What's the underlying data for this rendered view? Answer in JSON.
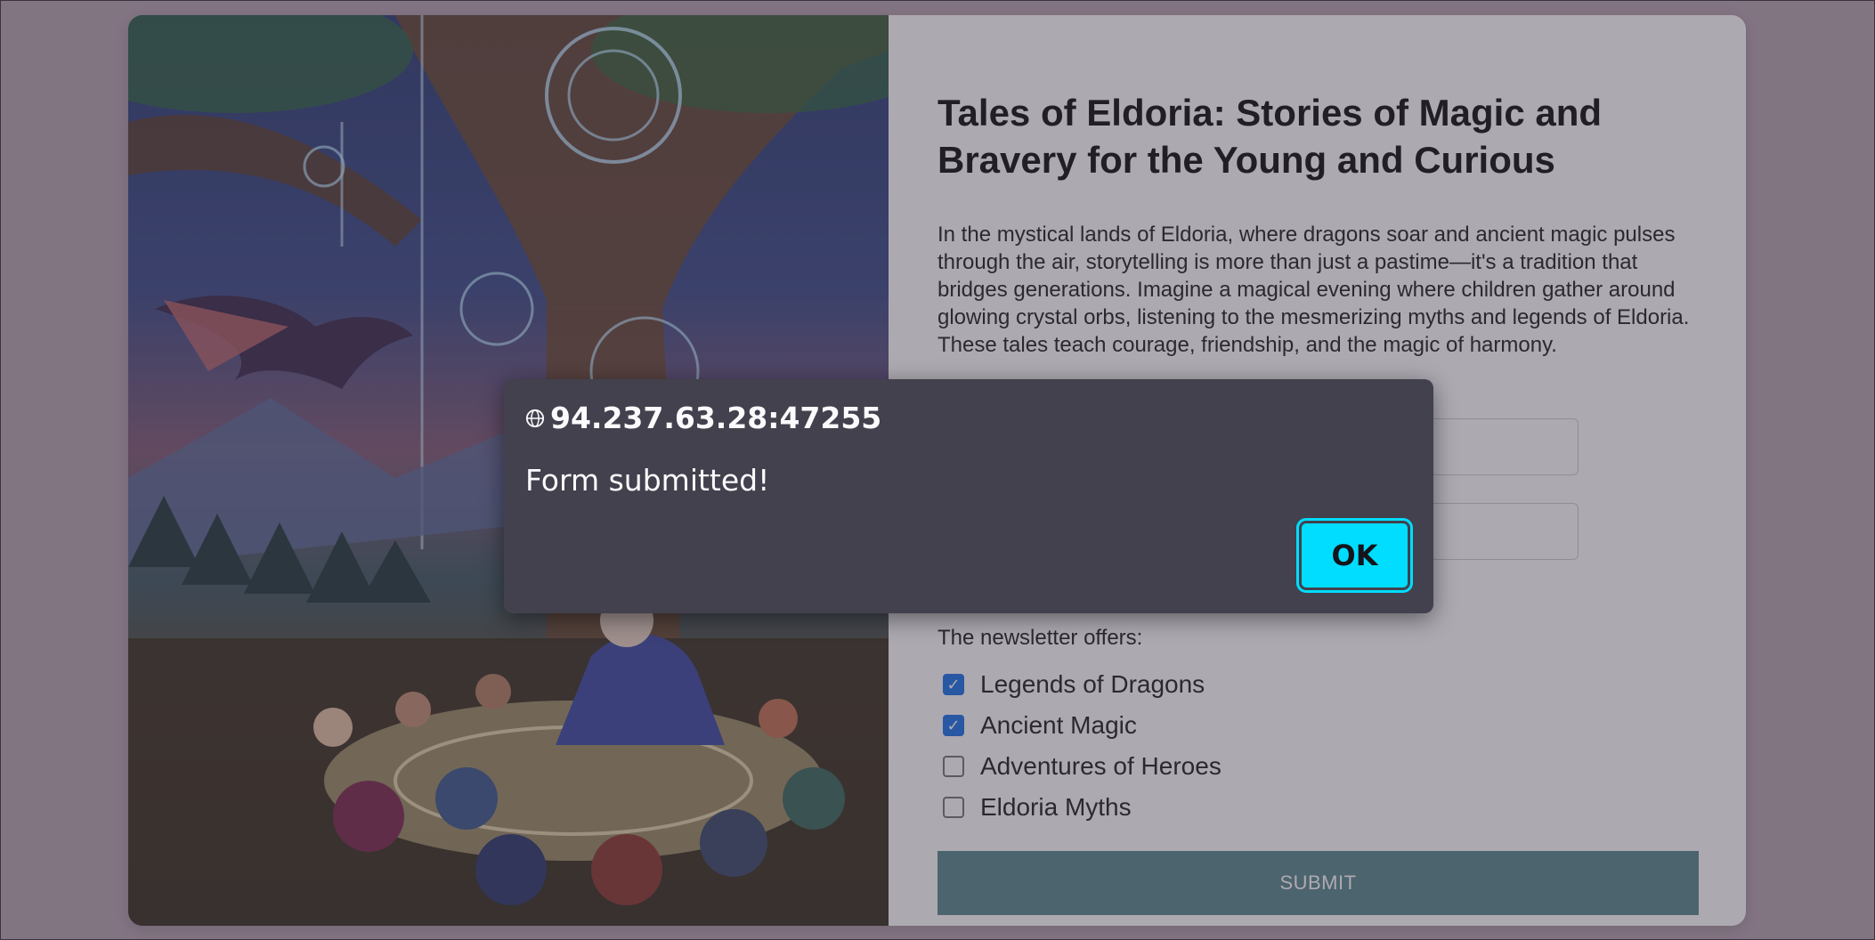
{
  "page": {
    "title": "Tales of Eldoria: Stories of Magic and Bravery for the Young and Curious",
    "description": "In the mystical lands of Eldoria, where dragons soar and ancient magic pulses through the air, storytelling is more than just a pastime—it's a tradition that bridges generations. Imagine a magical evening where children gather around glowing crystal orbs, listening to the mesmerizing myths and legends of Eldoria. These tales teach courage, friendship, and the magic of harmony."
  },
  "form": {
    "field1": {
      "value": "",
      "placeholder": ""
    },
    "field2": {
      "value": "",
      "placeholder": ""
    },
    "offers_label": "The newsletter offers:",
    "options": [
      {
        "label": "Legends of Dragons",
        "checked": true
      },
      {
        "label": "Ancient Magic",
        "checked": true
      },
      {
        "label": "Adventures of Heroes",
        "checked": false
      },
      {
        "label": "Eldoria Myths",
        "checked": false
      }
    ],
    "submit_label": "SUBMIT"
  },
  "dialog": {
    "origin": "94.237.63.28:47255",
    "message": "Form submitted!",
    "ok_label": "OK"
  },
  "colors": {
    "submit_bg": "#58898c",
    "ok_bg": "#00ddff",
    "dialog_bg": "#42414d"
  }
}
